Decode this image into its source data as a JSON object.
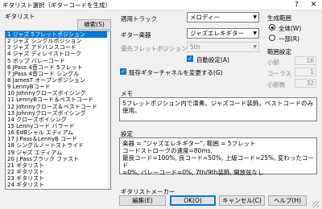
{
  "window": {
    "title": "ギタリスト選択（ギターコードを生成）",
    "help_glyph": "?",
    "close_glyph": "✕"
  },
  "guitarist": {
    "label": "ギタリスト",
    "search_label": "検索(S)",
    "items": [
      "1 ジャズ 5フレットポジション",
      "2 ジャズ シングルポジション",
      "3 ジャズ アドバンスコード",
      "4 ジャズ ディレイストローク",
      "5 ポップ バレーコード",
      "6 JPass 4音コード 5フレット",
      "7 JPass 4音コード シングル",
      "8 JamesT オープンポジション",
      "9 LennyBコード",
      "10 Johnnyクローズボイシング",
      "11 LennyBコード＆ベストコード",
      "12 Johnnyクローズ＆ベストコード",
      "13 Johnnyクローズボイシング",
      "14 クローズボイシング",
      "15 Lennyコード バラード",
      "16 EdBシャル エディアム",
      "17 J.Pass＆LennyB コード",
      "18 シングルノートストライド",
      "19 ジャズ エディアム",
      "20 J.Passブラック ファスト",
      "21 ギタリスト",
      "22 ギタリスト",
      "23 ギタリスト",
      "24 ギタリスト"
    ],
    "selected_index": 0
  },
  "settings": {
    "track_label": "適用トラック",
    "track_value": "メロディー",
    "instrument_label": "ギター楽器",
    "instrument_value": "ジャズエレキギター",
    "fret_label": "優先フレットポジション",
    "fret_value": "5th",
    "auto_setting_label": "自動設定(A)",
    "save_channel_label": "既存ギターチャネルを変更する(G)"
  },
  "range": {
    "label": "生成範囲",
    "all_label": "全体(W)",
    "partial_label": "一部(R)",
    "section_label": "範囲設定",
    "bar_label": "小節",
    "bar_value": "16",
    "chorus_label": "コーラス",
    "chorus_value": "1",
    "count_label": "小節数",
    "count_value": "32"
  },
  "memo": {
    "label": "メモ",
    "text": "5フレットポジション内で演奏。ジャズコード装飾。ベストコードのみ使用。"
  },
  "config": {
    "label": "設定",
    "line1": "楽器 = \"ジャズエレキギター\", 範囲 = 5フレット",
    "line2": "コードストロークの速度=80ms,",
    "line3": "最良コード=100%, 良コード=50%, 上級コード=25%, 変わったコード",
    "line4": "=0%, バレーコード=0%, 7th/9th装飾, 開放弦なし"
  },
  "maker": {
    "label": "ギタリストメーカー"
  },
  "buttons": {
    "edit": "編集(E)",
    "ok": "OK(O)",
    "cancel": "キャンセル(C)",
    "help": "ヘルプ(H)"
  }
}
